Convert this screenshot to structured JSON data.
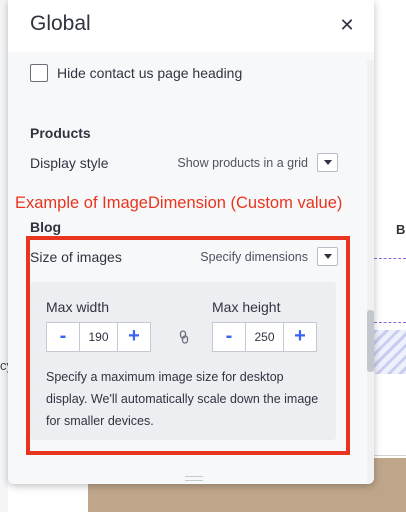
{
  "background": {
    "edge_glyph": "cy",
    "edge_letter": "B"
  },
  "panel": {
    "title": "Global",
    "close_icon": "close-icon"
  },
  "settings": {
    "hide_contact_heading": {
      "label": "Hide contact us page heading",
      "checked": false
    },
    "products": {
      "section_title": "Products",
      "display_style_label": "Display style",
      "display_style_value": "Show products in a grid"
    },
    "blog": {
      "section_title": "Blog",
      "size_label": "Size of images",
      "size_value": "Specify dimensions",
      "max_width_label": "Max width",
      "max_width_value": "190",
      "max_height_label": "Max height",
      "max_height_value": "250",
      "decrement_symbol": "-",
      "increment_symbol": "+",
      "link_icon": "chain-link-icon",
      "help_text": "Specify a maximum image size for desktop display. We'll automatically scale down the image for smaller devices."
    }
  },
  "annotation": {
    "text": "Example of ImageDimension (Custom value)",
    "color": "#e8351f"
  },
  "colors": {
    "accent": "#3c64f4",
    "panel_bg": "#f7f8fa",
    "dimension_box_bg": "#eceef2"
  }
}
